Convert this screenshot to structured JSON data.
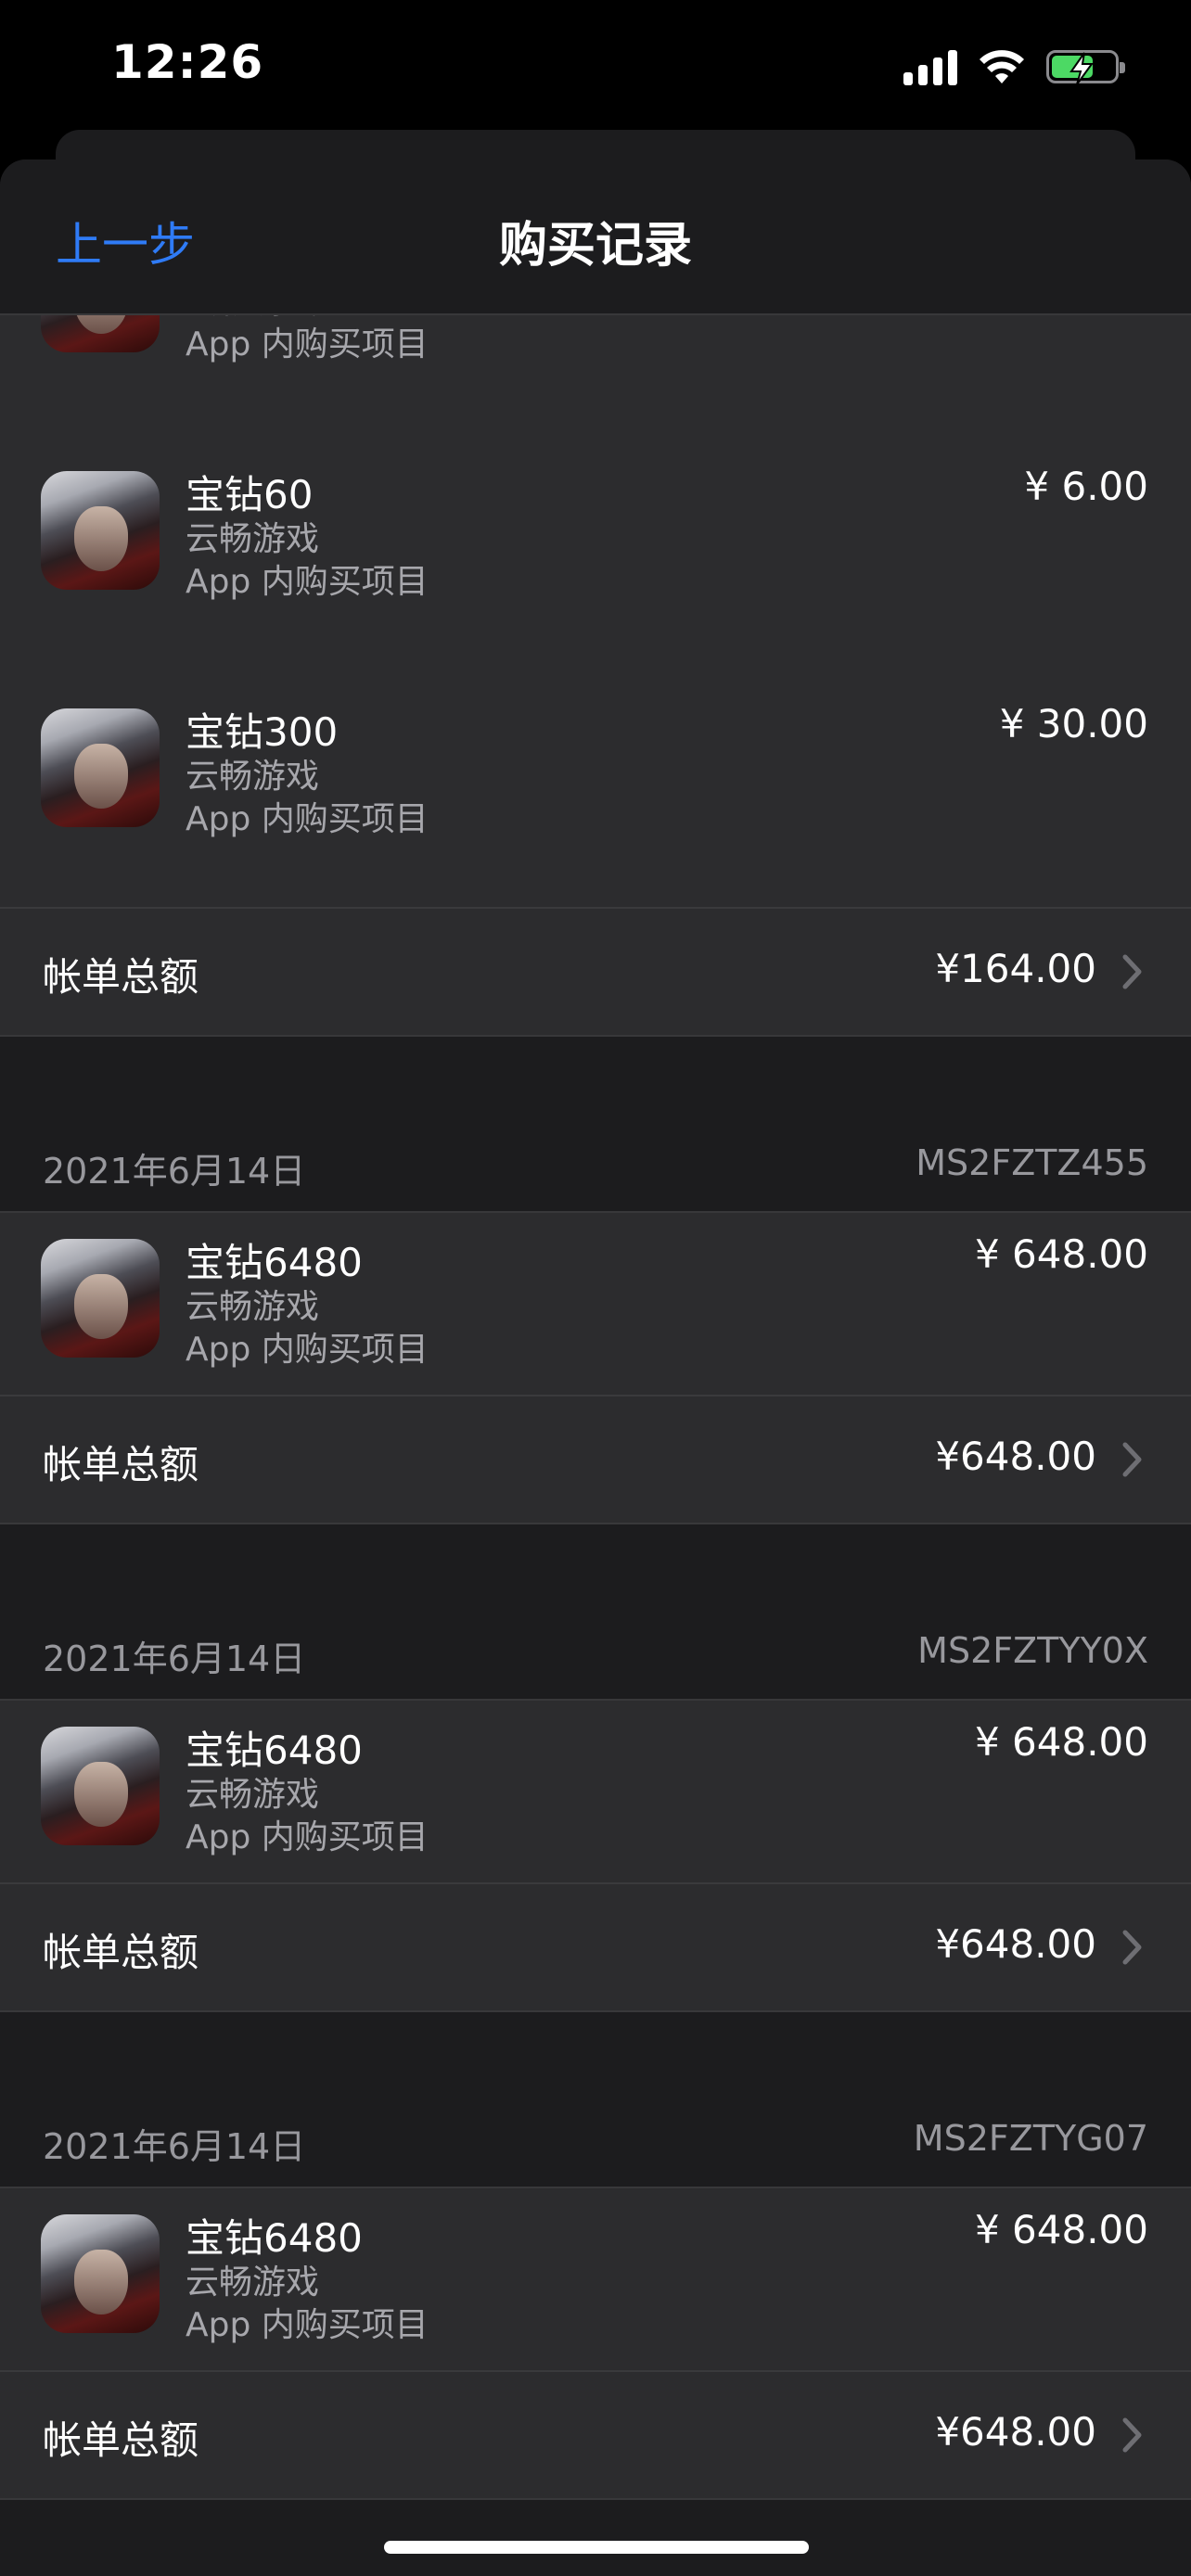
{
  "status_bar": {
    "time": "12:26"
  },
  "nav": {
    "back_label": "上一步",
    "title": "购买记录"
  },
  "partial_item": {
    "developer": "云畅游戏",
    "type": "App 内购买项目"
  },
  "top_group": {
    "items": [
      {
        "name": "宝钻60",
        "developer": "云畅游戏",
        "type": "App 内购买项目",
        "price": "¥ 6.00"
      },
      {
        "name": "宝钻300",
        "developer": "云畅游戏",
        "type": "App 内购买项目",
        "price": "¥ 30.00"
      }
    ],
    "total_label": "帐单总额",
    "total": "¥164.00"
  },
  "receipts": [
    {
      "date": "2021年6月14日",
      "order_id": "MS2FZTZ455",
      "item": {
        "name": "宝钻6480",
        "developer": "云畅游戏",
        "type": "App 内购买项目",
        "price": "¥ 648.00"
      },
      "total_label": "帐单总额",
      "total": "¥648.00"
    },
    {
      "date": "2021年6月14日",
      "order_id": "MS2FZTYY0X",
      "item": {
        "name": "宝钻6480",
        "developer": "云畅游戏",
        "type": "App 内购买项目",
        "price": "¥ 648.00"
      },
      "total_label": "帐单总额",
      "total": "¥648.00"
    },
    {
      "date": "2021年6月14日",
      "order_id": "MS2FZTYG07",
      "item": {
        "name": "宝钻6480",
        "developer": "云畅游戏",
        "type": "App 内购买项目",
        "price": "¥ 648.00"
      },
      "total_label": "帐单总额",
      "total": "¥648.00"
    }
  ],
  "colors": {
    "accent": "#2f7bf6",
    "background": "#1c1c1e",
    "row": "#2c2c2e",
    "secondary_text": "#a7a7ac"
  },
  "icons": {
    "app_icon": "game-character-app-icon",
    "chevron": "chevron-right-icon"
  }
}
